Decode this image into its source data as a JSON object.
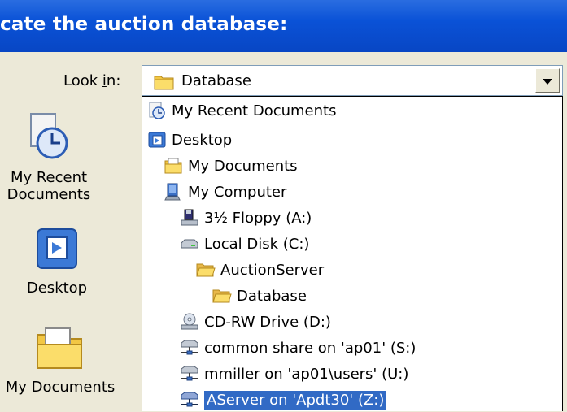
{
  "title": "cate the auction database:",
  "look_in": {
    "label": "Look in:",
    "value": "Database"
  },
  "dropdown_items": [
    {
      "label": "My Recent Documents",
      "icon": "recent-documents-icon"
    },
    {
      "label": "Desktop",
      "icon": "desktop-icon"
    },
    {
      "label": "My Documents",
      "icon": "my-documents-icon"
    },
    {
      "label": "My Computer",
      "icon": "my-computer-icon"
    },
    {
      "label": "3½ Floppy (A:)",
      "icon": "floppy-drive-icon"
    },
    {
      "label": "Local Disk (C:)",
      "icon": "hard-disk-icon"
    },
    {
      "label": "AuctionServer",
      "icon": "open-folder-icon"
    },
    {
      "label": "Database",
      "icon": "open-folder-icon"
    },
    {
      "label": "CD-RW Drive (D:)",
      "icon": "cd-drive-icon"
    },
    {
      "label": "common share on 'ap01' (S:)",
      "icon": "network-drive-icon"
    },
    {
      "label": "mmiller on 'ap01\\users' (U:)",
      "icon": "network-drive-icon"
    },
    {
      "label": "AServer on 'Apdt30' (Z:)",
      "icon": "network-drive-icon",
      "selected": true
    }
  ],
  "places": [
    {
      "label": "My Recent Documents",
      "icon": "recent-documents-icon"
    },
    {
      "label": "Desktop",
      "icon": "desktop-icon"
    },
    {
      "label": "My Documents",
      "icon": "my-documents-icon"
    }
  ],
  "colors": {
    "titlebar": "#0A52D7",
    "selection": "#316AC5",
    "dialog": "#ECE9D8"
  }
}
